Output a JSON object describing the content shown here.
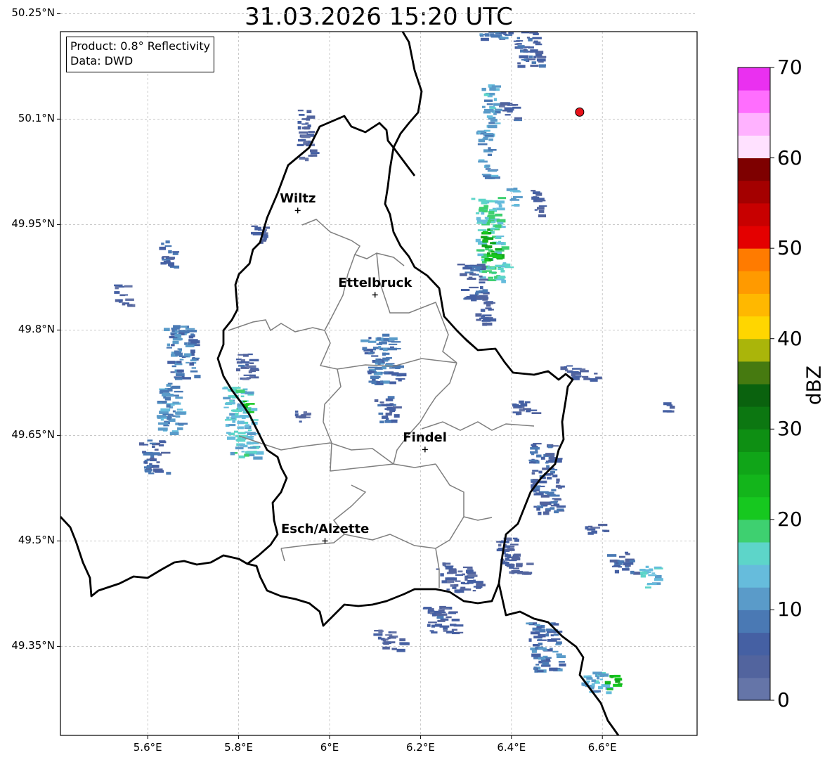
{
  "title": "31.03.2026 15:20 UTC",
  "info": {
    "product": "Product: 0.8° Reflectivity",
    "data": "Data: DWD"
  },
  "axes": {
    "lon_range": [
      5.4,
      6.8
    ],
    "lat_range": [
      49.3,
      50.3
    ],
    "lat_ticks": [
      {
        "value": 50.25,
        "label": "50.25°N"
      },
      {
        "value": 50.1,
        "label": "50.1°N"
      },
      {
        "value": 49.95,
        "label": "49.95°N"
      },
      {
        "value": 49.8,
        "label": "49.8°N"
      },
      {
        "value": 49.65,
        "label": "49.65°N"
      },
      {
        "value": 49.5,
        "label": "49.5°N"
      },
      {
        "value": 49.35,
        "label": "49.35°N"
      }
    ],
    "lon_ticks": [
      {
        "value": 5.6,
        "label": "5.6°E"
      },
      {
        "value": 5.8,
        "label": "5.8°E"
      },
      {
        "value": 6.0,
        "label": "6°E"
      },
      {
        "value": 6.2,
        "label": "6.2°E"
      },
      {
        "value": 6.4,
        "label": "6.4°E"
      },
      {
        "value": 6.6,
        "label": "6.6°E"
      }
    ],
    "grid": true
  },
  "cities": [
    {
      "name": "Wiltz",
      "lon": 5.93,
      "lat": 49.97
    },
    {
      "name": "Ettelbruck",
      "lon": 6.1,
      "lat": 49.85
    },
    {
      "name": "Findel",
      "lon": 6.21,
      "lat": 49.63
    },
    {
      "name": "Esch/Alzette",
      "lon": 5.99,
      "lat": 49.5
    }
  ],
  "radar_site": {
    "lon": 6.55,
    "lat": 50.11,
    "color": "#e8121a"
  },
  "colorbar": {
    "label": "dBZ",
    "min": 0,
    "max": 70,
    "step": 2.5,
    "tick_labels": [
      "0",
      "10",
      "20",
      "30",
      "40",
      "50",
      "60",
      "70"
    ],
    "colors": [
      "#6575a8",
      "#52649e",
      "#4560a3",
      "#4a79b4",
      "#5a9bc9",
      "#66bcdc",
      "#5dd5c9",
      "#3ed070",
      "#16c81f",
      "#13b51b",
      "#10a518",
      "#0e8f13",
      "#0c7711",
      "#0a620e",
      "#467a10",
      "#aab50a",
      "#ffd600",
      "#ffb800",
      "#ff9a00",
      "#ff7b00",
      "#e40000",
      "#c80000",
      "#a40000",
      "#7e0000",
      "#ffe1ff",
      "#ffb2ff",
      "#ff6efe",
      "#ea30f0"
    ]
  },
  "echoes": [
    {
      "lon": 6.36,
      "lat": 50.25,
      "w": 0.09,
      "h": 0.07,
      "dbz": 8
    },
    {
      "lon": 6.42,
      "lat": 50.27,
      "w": 0.06,
      "h": 0.03,
      "dbz": 20
    },
    {
      "lon": 6.43,
      "lat": 50.21,
      "w": 0.05,
      "h": 0.07,
      "dbz": 6
    },
    {
      "lon": 6.35,
      "lat": 50.12,
      "w": 0.03,
      "h": 0.06,
      "dbz": 12
    },
    {
      "lon": 6.34,
      "lat": 50.05,
      "w": 0.03,
      "h": 0.07,
      "dbz": 10
    },
    {
      "lon": 6.39,
      "lat": 50.11,
      "w": 0.03,
      "h": 0.03,
      "dbz": 4
    },
    {
      "lon": 6.4,
      "lat": 49.99,
      "w": 0.02,
      "h": 0.03,
      "dbz": 12
    },
    {
      "lon": 6.45,
      "lat": 49.98,
      "w": 0.02,
      "h": 0.04,
      "dbz": 4
    },
    {
      "lon": 6.35,
      "lat": 49.93,
      "w": 0.06,
      "h": 0.12,
      "dbz": 16
    },
    {
      "lon": 6.35,
      "lat": 49.92,
      "w": 0.03,
      "h": 0.05,
      "dbz": 24
    },
    {
      "lon": 6.31,
      "lat": 49.87,
      "w": 0.05,
      "h": 0.05,
      "dbz": 6
    },
    {
      "lon": 6.33,
      "lat": 49.83,
      "w": 0.04,
      "h": 0.04,
      "dbz": 4
    },
    {
      "lon": 6.11,
      "lat": 49.76,
      "w": 0.07,
      "h": 0.07,
      "dbz": 8
    },
    {
      "lon": 6.12,
      "lat": 49.69,
      "w": 0.04,
      "h": 0.04,
      "dbz": 6
    },
    {
      "lon": 5.67,
      "lat": 49.77,
      "w": 0.06,
      "h": 0.08,
      "dbz": 8
    },
    {
      "lon": 5.64,
      "lat": 49.69,
      "w": 0.05,
      "h": 0.07,
      "dbz": 10
    },
    {
      "lon": 5.61,
      "lat": 49.62,
      "w": 0.05,
      "h": 0.05,
      "dbz": 6
    },
    {
      "lon": 5.8,
      "lat": 49.67,
      "w": 0.06,
      "h": 0.1,
      "dbz": 14
    },
    {
      "lon": 5.81,
      "lat": 49.69,
      "w": 0.02,
      "h": 0.02,
      "dbz": 22
    },
    {
      "lon": 5.81,
      "lat": 49.75,
      "w": 0.04,
      "h": 0.04,
      "dbz": 4
    },
    {
      "lon": 5.64,
      "lat": 49.91,
      "w": 0.03,
      "h": 0.04,
      "dbz": 6
    },
    {
      "lon": 5.54,
      "lat": 49.85,
      "w": 0.03,
      "h": 0.03,
      "dbz": 4
    },
    {
      "lon": 5.94,
      "lat": 50.08,
      "w": 0.03,
      "h": 0.07,
      "dbz": 4
    },
    {
      "lon": 5.84,
      "lat": 49.94,
      "w": 0.03,
      "h": 0.03,
      "dbz": 4
    },
    {
      "lon": 5.93,
      "lat": 49.68,
      "w": 0.03,
      "h": 0.02,
      "dbz": 4
    },
    {
      "lon": 6.47,
      "lat": 49.59,
      "w": 0.06,
      "h": 0.1,
      "dbz": 6
    },
    {
      "lon": 6.4,
      "lat": 49.48,
      "w": 0.06,
      "h": 0.05,
      "dbz": 4
    },
    {
      "lon": 6.28,
      "lat": 49.45,
      "w": 0.08,
      "h": 0.04,
      "dbz": 4
    },
    {
      "lon": 6.47,
      "lat": 49.35,
      "w": 0.06,
      "h": 0.07,
      "dbz": 8
    },
    {
      "lon": 6.24,
      "lat": 49.39,
      "w": 0.06,
      "h": 0.04,
      "dbz": 4
    },
    {
      "lon": 6.13,
      "lat": 49.36,
      "w": 0.06,
      "h": 0.03,
      "dbz": 4
    },
    {
      "lon": 6.64,
      "lat": 49.47,
      "w": 0.05,
      "h": 0.03,
      "dbz": 6
    },
    {
      "lon": 6.7,
      "lat": 49.45,
      "w": 0.04,
      "h": 0.03,
      "dbz": 14
    },
    {
      "lon": 6.58,
      "lat": 49.3,
      "w": 0.06,
      "h": 0.03,
      "dbz": 12
    },
    {
      "lon": 6.62,
      "lat": 49.3,
      "w": 0.03,
      "h": 0.02,
      "dbz": 22
    },
    {
      "lon": 6.58,
      "lat": 49.52,
      "w": 0.04,
      "h": 0.015,
      "dbz": 4
    },
    {
      "lon": 6.55,
      "lat": 49.74,
      "w": 0.07,
      "h": 0.02,
      "dbz": 4
    },
    {
      "lon": 6.42,
      "lat": 49.69,
      "w": 0.05,
      "h": 0.02,
      "dbz": 4
    },
    {
      "lon": 6.74,
      "lat": 49.69,
      "w": 0.02,
      "h": 0.015,
      "dbz": 4
    }
  ]
}
